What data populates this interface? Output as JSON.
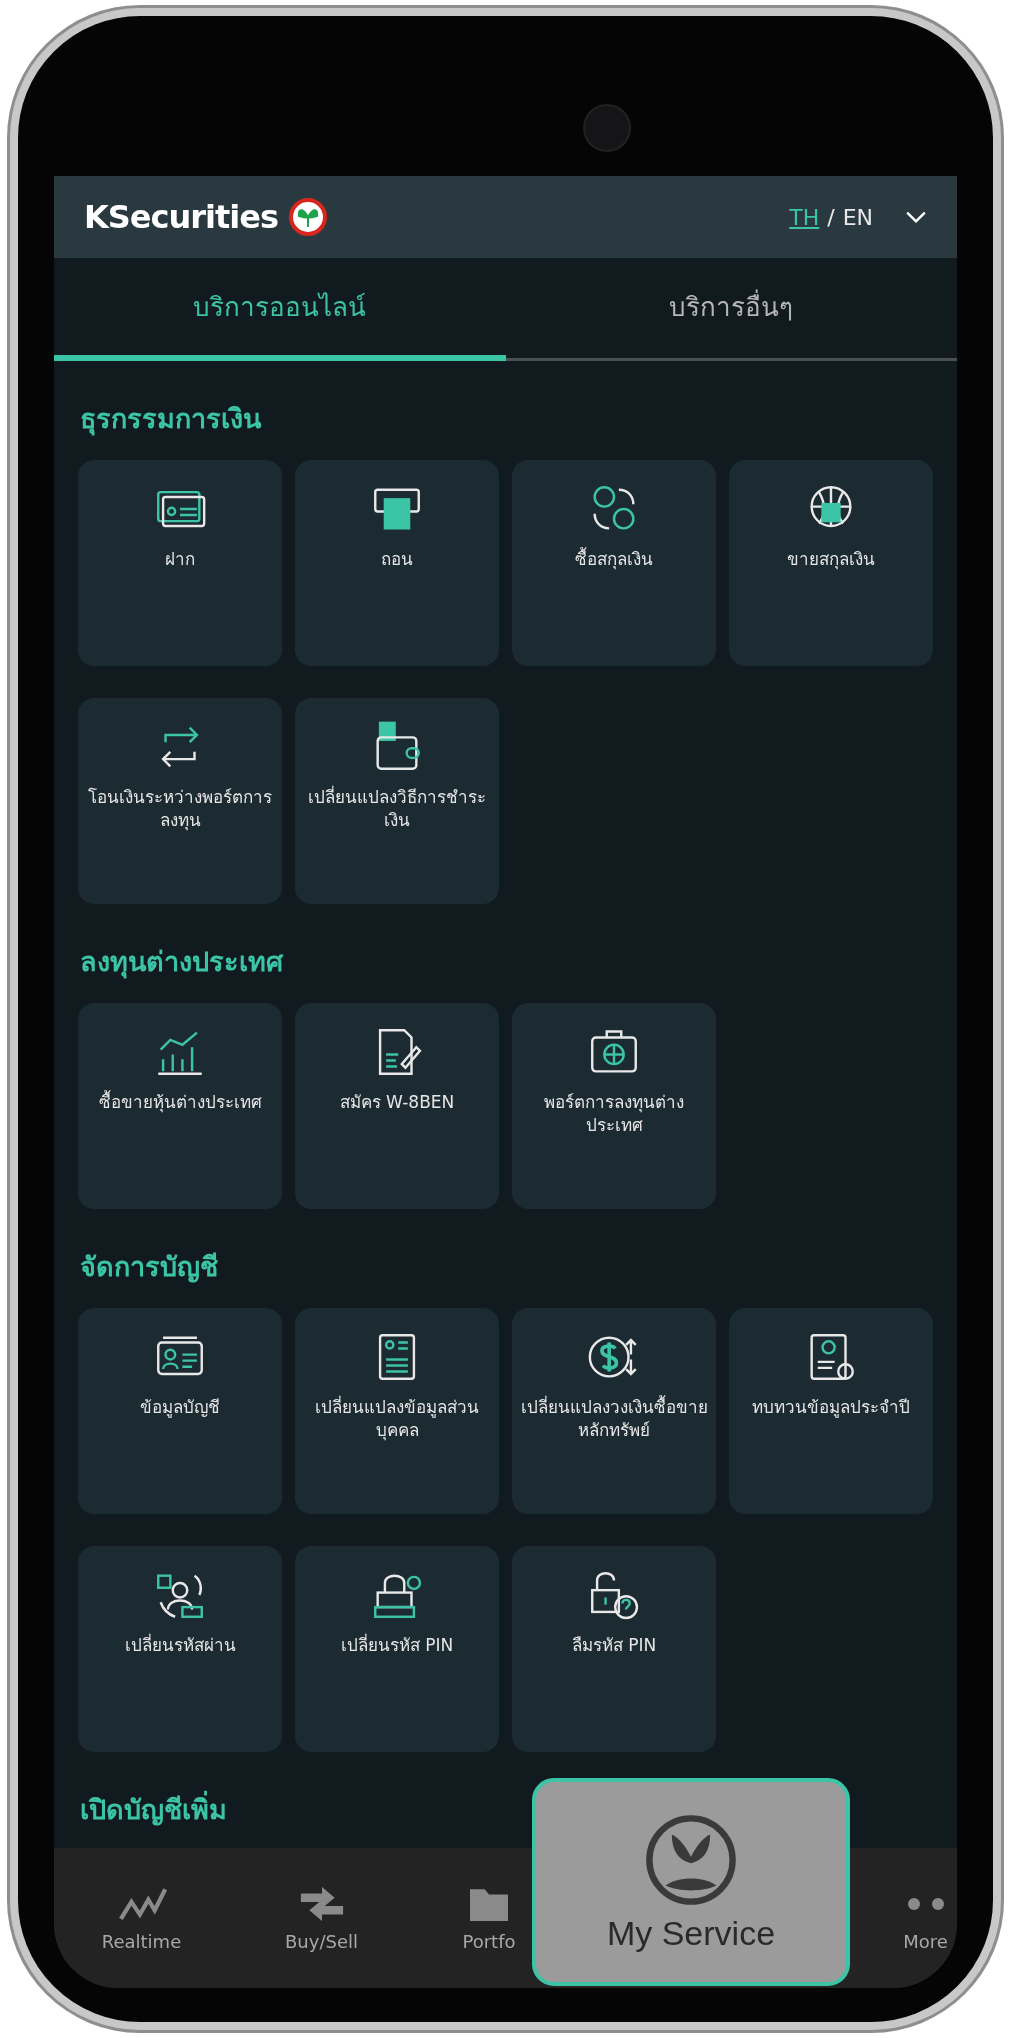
{
  "header": {
    "logo": "KSecurities",
    "languages": [
      {
        "label": "TH",
        "selected": true
      },
      {
        "label": "EN",
        "selected": false
      }
    ],
    "separator": "/"
  },
  "tabs": [
    {
      "label": "บริการออนไลน์",
      "selected": true
    },
    {
      "label": "บริการอื่นๆ",
      "selected": false
    }
  ],
  "sections": [
    {
      "title": "ธุรกรรมการเงิน",
      "items": [
        "ฝาก",
        "ถอน",
        "ซื้อสกุลเงิน",
        "ขายสกุลเงิน",
        "โอนเงินระหว่างพอร์ตการลงทุน",
        "เปลี่ยนแปลงวิธีการชำระเงิน"
      ]
    },
    {
      "title": "ลงทุนต่างประเทศ",
      "items": [
        "ซื้อขายหุ้นต่างประเทศ",
        "สมัคร W-8BEN",
        "พอร์ตการลงทุนต่างประเทศ"
      ]
    },
    {
      "title": "จัดการบัญชี",
      "items": [
        "ข้อมูลบัญชี",
        "เปลี่ยนแปลงข้อมูลส่วนบุคคล",
        "เปลี่ยนแปลงวงเงินซื้อขายหลักทรัพย์",
        "ทบทวนข้อมูลประจำปี",
        "เปลี่ยนรหัสผ่าน",
        "เปลี่ยนรหัส PIN",
        "ลืมรหัส PIN"
      ]
    },
    {
      "title": "เปิดบัญชีเพิ่ม"
    }
  ],
  "bottom_nav": [
    "Realtime",
    "Buy/Sell",
    "Portfo",
    "More"
  ],
  "popup": {
    "label": "My Service"
  }
}
